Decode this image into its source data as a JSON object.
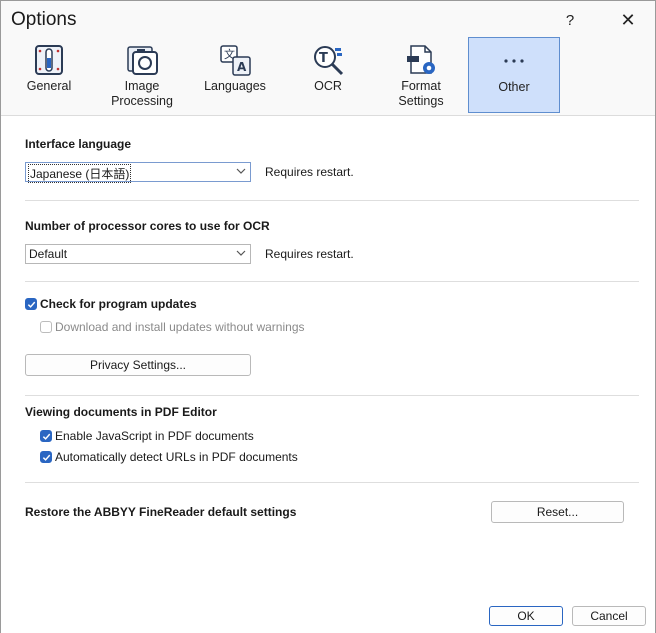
{
  "window": {
    "title": "Options",
    "help_label": "?",
    "close_label": "✕"
  },
  "tabs": [
    {
      "label_line1": "General",
      "label_line2": ""
    },
    {
      "label_line1": "Image",
      "label_line2": "Processing"
    },
    {
      "label_line1": "Languages",
      "label_line2": ""
    },
    {
      "label_line1": "OCR",
      "label_line2": ""
    },
    {
      "label_line1": "Format",
      "label_line2": "Settings"
    },
    {
      "label_line1": "Other",
      "label_line2": ""
    }
  ],
  "interface_language": {
    "heading": "Interface language",
    "value": "Japanese (日本語)",
    "note": "Requires restart."
  },
  "processor_cores": {
    "heading": "Number of processor cores to use for OCR",
    "value": "Default",
    "note": "Requires restart."
  },
  "updates": {
    "check_label": "Check for program updates",
    "check_checked": true,
    "download_label": "Download and install updates without warnings",
    "download_checked": false,
    "privacy_button": "Privacy Settings..."
  },
  "pdf_editor": {
    "heading": "Viewing documents in PDF Editor",
    "javascript_label": "Enable JavaScript in PDF documents",
    "javascript_checked": true,
    "urls_label": "Automatically detect URLs in PDF documents",
    "urls_checked": true
  },
  "restore": {
    "heading": "Restore the ABBYY FineReader default settings",
    "reset_button": "Reset..."
  },
  "footer": {
    "ok_label": "OK",
    "cancel_label": "Cancel"
  },
  "colors": {
    "accent": "#2a66c2",
    "active_tab_bg": "#cfe0fb"
  }
}
